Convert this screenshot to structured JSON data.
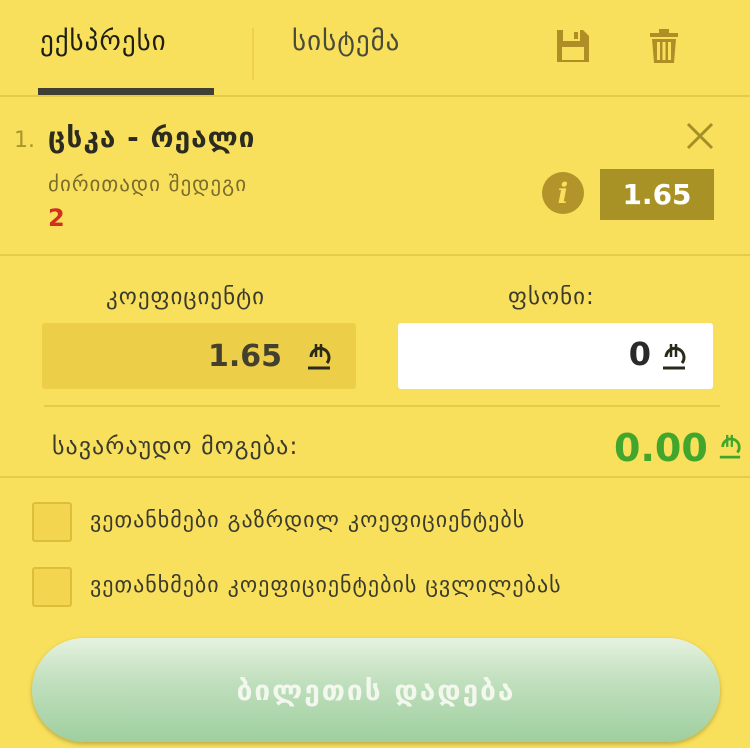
{
  "tabs": [
    {
      "label": "ექსპრესი",
      "active": true
    },
    {
      "label": "სისტემა",
      "active": false
    }
  ],
  "toolbar": {
    "save_icon": "save-icon",
    "trash_icon": "trash-icon"
  },
  "pick": {
    "number": "1.",
    "event": "ცსკა - რეალი",
    "market": "ძირითადი შედეგი",
    "outcome": "2",
    "odds": "1.65",
    "info_icon_glyph": "i"
  },
  "slip": {
    "coef_label": "კოეფიციენტი",
    "coef_value": "1.65",
    "stake_label": "ფსონი:",
    "stake_value": "0",
    "currency_symbol": "₾",
    "win_label": "სავარაუდო მოგება:",
    "win_value": "0.00"
  },
  "options": [
    {
      "label": "ვეთანხმები გაზრდილ კოეფიციენტებს",
      "checked": false
    },
    {
      "label": "ვეთანხმები კოეფიციენტების ცვლილებას",
      "checked": false
    }
  ],
  "place_bet_label": "ბილეთის დადება",
  "colors": {
    "background": "#f9e05c",
    "odds_bg": "#a99225",
    "win": "#41a62b",
    "outcome": "#d22f1f"
  }
}
